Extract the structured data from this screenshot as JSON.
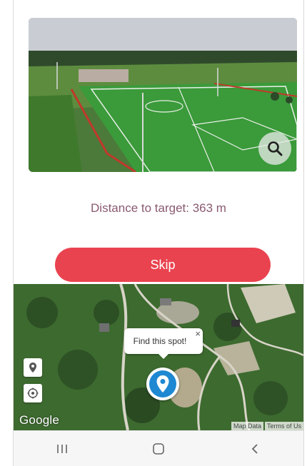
{
  "photo": {
    "alt": "Aerial view of soccer fields",
    "zoom_icon": "magnifier-icon"
  },
  "distance_text": "Distance to target: 363 m",
  "skip_label": "Skip",
  "map": {
    "tooltip_text": "Find this spot!",
    "tooltip_close": "×",
    "pin_icon": "location-pin-icon",
    "controls": [
      "marker-icon",
      "compass-icon"
    ],
    "logo": "Google",
    "attribution": [
      "Map Data",
      "Terms of Us"
    ]
  },
  "navbar": {
    "icons": [
      "recent-apps-icon",
      "home-icon",
      "back-icon"
    ]
  },
  "colors": {
    "accent": "#e9434f",
    "distance_text": "#8a5a70",
    "pin": "#1e88d2"
  }
}
